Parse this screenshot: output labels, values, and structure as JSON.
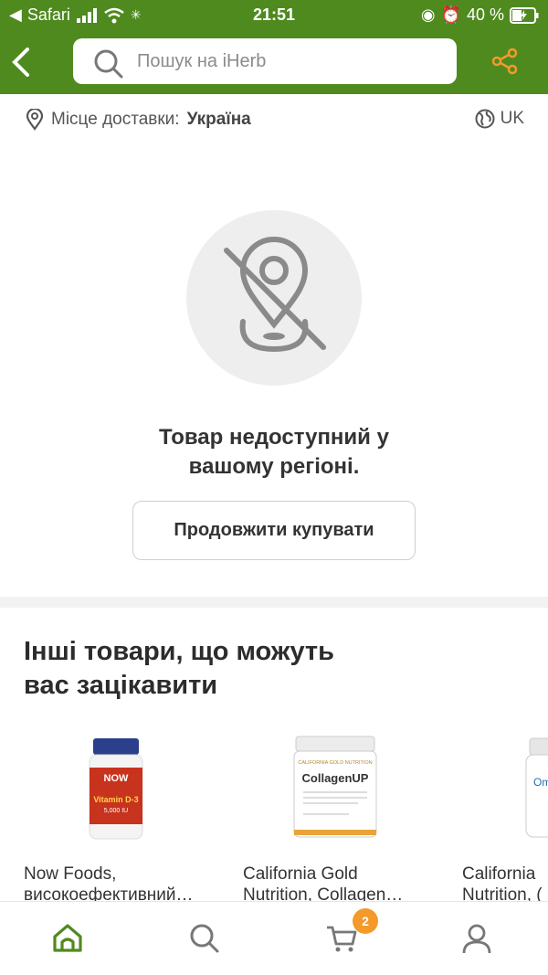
{
  "status_bar": {
    "back_app": "Safari",
    "time": "21:51",
    "battery": "40 %"
  },
  "search": {
    "placeholder": "Пошук на iHerb"
  },
  "delivery": {
    "label": "Місце доставки:",
    "country": "Україна",
    "language": "UK"
  },
  "empty_state": {
    "message_line1": "Товар недоступний у",
    "message_line2": "вашому регіоні.",
    "button": "Продовжити купувати"
  },
  "recommendations": {
    "title_line1": "Інші товари, що можуть",
    "title_line2": "вас зацікавити",
    "products": [
      {
        "name_line1": "Now Foods,",
        "name_line2": "високоефективний…",
        "brand": "NOW",
        "label": "Vitamin D-3",
        "sub": "5,000 IU"
      },
      {
        "name_line1": "California Gold",
        "name_line2": "Nutrition, Collagen…",
        "brand": "CALIFORNIA GOLD NUTRITION",
        "label": "CollagenUP"
      },
      {
        "name_line1": "California",
        "name_line2": "Nutrition, (",
        "label": "Om"
      }
    ]
  },
  "tab_bar": {
    "cart_count": "2",
    "items": [
      "home-icon",
      "search-icon",
      "cart-icon",
      "account-icon"
    ]
  },
  "colors": {
    "brand_green": "#4f8a1f",
    "accent_orange": "#f39a2b"
  }
}
